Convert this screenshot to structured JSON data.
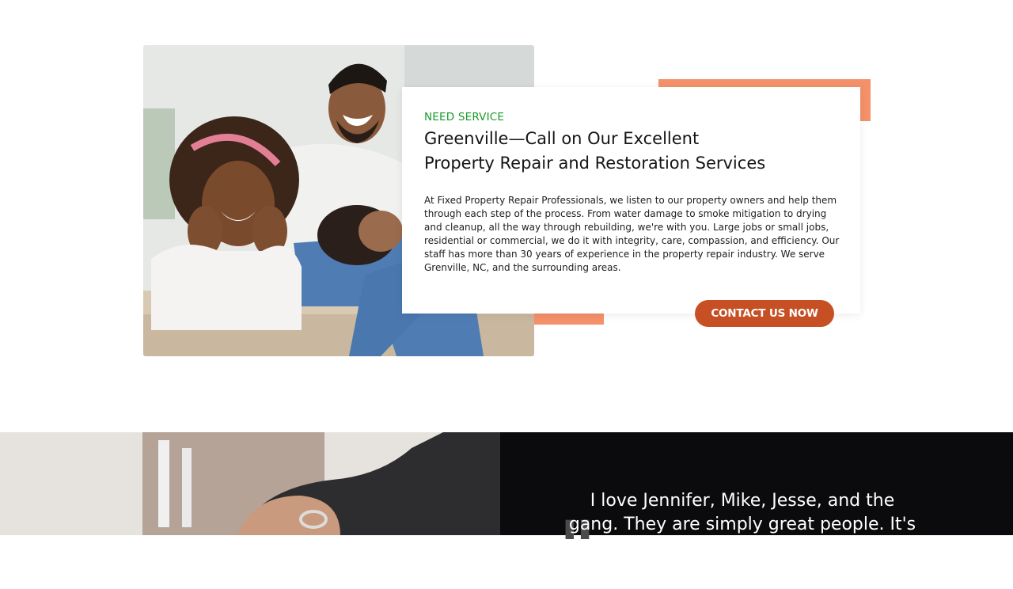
{
  "service": {
    "eyebrow": "NEED SERVICE",
    "title": "Greenville—Call on Our Excellent Property Repair and Restoration Services",
    "body": "At Fixed Property Repair Professionals, we listen to our property owners and help them through each step of the process. From water damage to smoke mitigation to drying and cleanup, all the way through rebuilding, we're with you. Large jobs or small jobs, residential or commercial, we do it with integrity, care, compassion, and efficiency. Our staff has more than 30 years of experience in the property repair industry. We serve Grenville, NC, and the surrounding areas.",
    "cta_label": "CONTACT US NOW"
  },
  "testimonial": {
    "quote": "I love Jennifer, Mike, Jesse, and the gang. They are simply great people. It's"
  },
  "colors": {
    "accent": "#f4916a",
    "cta": "#c64f24",
    "eyebrow": "#1a9a2a",
    "dark_panel": "#0b0b0d"
  }
}
